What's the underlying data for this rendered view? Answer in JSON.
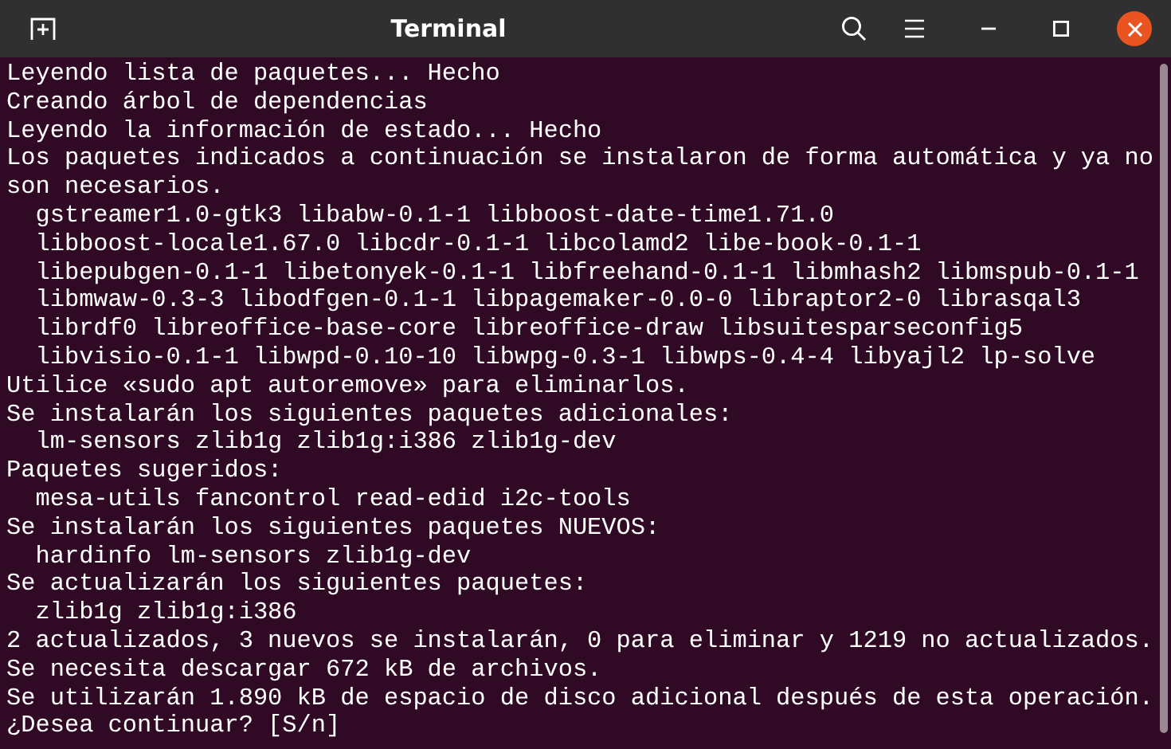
{
  "window": {
    "title": "Terminal"
  },
  "terminal": {
    "lines": [
      "Leyendo lista de paquetes... Hecho",
      "Creando árbol de dependencias",
      "Leyendo la información de estado... Hecho",
      "Los paquetes indicados a continuación se instalaron de forma automática y ya no",
      "son necesarios.",
      "  gstreamer1.0-gtk3 libabw-0.1-1 libboost-date-time1.71.0",
      "  libboost-locale1.67.0 libcdr-0.1-1 libcolamd2 libe-book-0.1-1",
      "  libepubgen-0.1-1 libetonyek-0.1-1 libfreehand-0.1-1 libmhash2 libmspub-0.1-1",
      "  libmwaw-0.3-3 libodfgen-0.1-1 libpagemaker-0.0-0 libraptor2-0 librasqal3",
      "  librdf0 libreoffice-base-core libreoffice-draw libsuitesparseconfig5",
      "  libvisio-0.1-1 libwpd-0.10-10 libwpg-0.3-1 libwps-0.4-4 libyajl2 lp-solve",
      "Utilice «sudo apt autoremove» para eliminarlos.",
      "Se instalarán los siguientes paquetes adicionales:",
      "  lm-sensors zlib1g zlib1g:i386 zlib1g-dev",
      "Paquetes sugeridos:",
      "  mesa-utils fancontrol read-edid i2c-tools",
      "Se instalarán los siguientes paquetes NUEVOS:",
      "  hardinfo lm-sensors zlib1g-dev",
      "Se actualizarán los siguientes paquetes:",
      "  zlib1g zlib1g:i386",
      "2 actualizados, 3 nuevos se instalarán, 0 para eliminar y 1219 no actualizados.",
      "Se necesita descargar 672 kB de archivos.",
      "Se utilizarán 1.890 kB de espacio de disco adicional después de esta operación.",
      "¿Desea continuar? [S/n]"
    ]
  }
}
